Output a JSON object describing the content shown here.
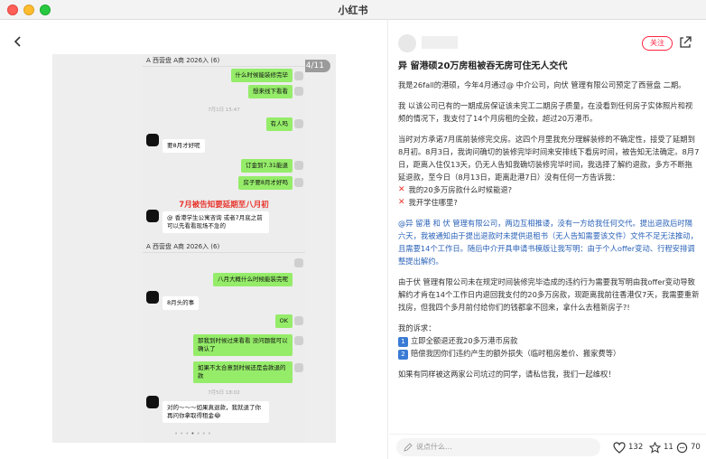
{
  "window": {
    "title": "小红书"
  },
  "gallery": {
    "page_indicator": "4/11",
    "chat": {
      "header1": "A 西营盘 A商 2026入 (6)",
      "header2": "A 西营盘 A商 2026入 (6)",
      "messages": [
        {
          "side": "right",
          "text": "什么时候能装修完毕"
        },
        {
          "side": "right",
          "text": "想来线下看看"
        },
        {
          "side": "stamp",
          "text": "7月1日 15:47"
        },
        {
          "side": "right",
          "text": "有人吗"
        },
        {
          "side": "left",
          "text": "要8月才好呢"
        },
        {
          "side": "right",
          "text": "订金到7.31能退"
        },
        {
          "side": "right",
          "text": "房子要8月才好吗"
        },
        {
          "side": "left",
          "text": "@ 香港学生公寓咨询 或者7月底之前可以先看看现场不急的"
        },
        {
          "side": "right",
          "text": "八月大概什么时候能装完呢"
        },
        {
          "side": "left",
          "text": "8月头的事"
        },
        {
          "side": "right",
          "text": "OK"
        },
        {
          "side": "right",
          "text": "那我到时候过来看看 没问题我可以确认了"
        },
        {
          "side": "right",
          "text": "如果不太合意到时候还是会款退的款"
        },
        {
          "side": "stamp",
          "text": "7月5日 18:02"
        },
        {
          "side": "left",
          "text": "对的～～～如果真退款，我就退了你再问你拿取得租金😂"
        }
      ],
      "red_caption": "7月被告知要延期至八月初"
    }
  },
  "post": {
    "follow_label": "关注",
    "title": "异 留港硕20万房租被吞无房可住无人交代",
    "paragraphs": [
      "我是26fall的港硕，今年4月通过@ 中介公司，向伏 管理有限公司预定了西营盘 二期。",
      "我 以该公司已有的一期成房保证该未完工二期房子质量，在没看到任何房子实体照片和视频的情况下，我支付了14个月房租的全款，超过20万港币。",
      "当时对方承诺7月底前装修完交房。这四个月里我充分理解装修的不确定性，接受了延期到8月初。8月3日，我询问确切的装修完毕时间来安排线下看房时间，被告知无法确定。8月7日，距离入住仅13天，仍无人告知我确切装修完毕时间，我选择了解约退款，多方不断拖延退款，至今日（8月13日，距离赴港7日）没有任何一方告诉我："
    ],
    "questions": [
      "我的20多万房款什么时候能退?",
      "我开学住哪里?"
    ],
    "paragraph_mention": "@异 留港 和 伏 管理有限公司，两边互相推诿，没有一方给我任何交代。提出退款后时隔六天，我被通知由于提出退款时未提供退租书（无人告知需要该文件）文件不足无法推动，且需要14个工作日。随后中介开具申请书模版让我写明：由于个人offer变动、行程安排调整提出解约。",
    "paragraph_demand": "由于伏 管理有限公司未在规定时间装修完毕造成的违约行为需要我写明由我offer变动导致解约才肯在14个工作日内退回我支付的20多万房款，现距离我前往香港仅7天，我需要重新找房，但我四个多月前付给你们的钱都拿不回来，拿什么去租新房子?!",
    "demands_label": "我的诉求：",
    "demands": [
      "立即全额退还我20多万港币房款",
      "赔偿我因你们违约产生的额外损失（临时租房差价、搬家费等）"
    ],
    "closing": "如果有同样被这两家公司坑过的同学，请私信我，我们一起维权！"
  },
  "bottom": {
    "comment_placeholder": "说点什么...",
    "likes": "132",
    "favorites": "11",
    "comments": "70"
  }
}
